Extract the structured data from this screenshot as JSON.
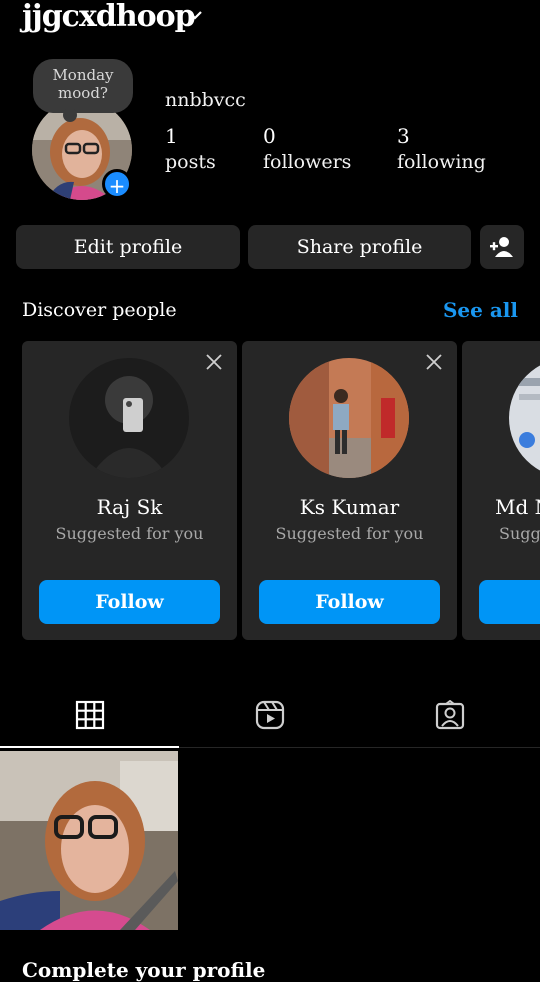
{
  "header": {
    "username": "jjgcxdhoop"
  },
  "profile": {
    "note": "Monday mood?",
    "full_name": "nnbbvcc",
    "stats": [
      {
        "num": "1",
        "label": "posts"
      },
      {
        "num": "0",
        "label": "followers"
      },
      {
        "num": "3",
        "label": "following"
      }
    ]
  },
  "actions": {
    "edit": "Edit profile",
    "share": "Share profile",
    "add_person_icon": "add-person-icon"
  },
  "discover": {
    "title": "Discover people",
    "see_all": "See all",
    "cards": [
      {
        "name": "Raj Sk",
        "sub": "Suggested for you",
        "follow": "Follow"
      },
      {
        "name": "Ks Kumar",
        "sub": "Suggested for you",
        "follow": "Follow"
      },
      {
        "name": "Md N",
        "sub": "Sugge",
        "follow": "F"
      }
    ]
  },
  "tabs": [
    "grid-icon",
    "reels-icon",
    "tagged-icon"
  ],
  "footer": {
    "complete": "Complete your profile"
  },
  "colors": {
    "accent": "#0095f6",
    "background": "#000000",
    "card": "#262626"
  }
}
